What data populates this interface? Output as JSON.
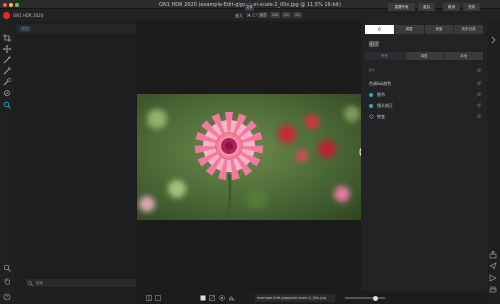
{
  "window": {
    "title": "ON1 HDR 2020 (example-Edit-gigapixel-scale-2_00x.jpg @ 11.5% 16-bit)"
  },
  "app": {
    "name": "ON1 HDR 2020"
  },
  "zoom": {
    "label": "放大",
    "value": "11.67",
    "buttons": [
      "适合",
      "100",
      "50",
      "25"
    ]
  },
  "left_panel": {
    "tab_label": "浏览",
    "search_placeholder": "搜索"
  },
  "right_panel": {
    "tabs": [
      "合",
      "调整",
      "遮盖",
      "历史记录"
    ],
    "section_title": "图层",
    "subtabs": [
      "所有",
      "调整",
      "本地"
    ],
    "layer_badge": "(0)",
    "group_label": "色调&&颜色",
    "rows": [
      "细节",
      "镜头校正",
      "转变"
    ]
  },
  "bottom": {
    "filename_label": "文件 ▸",
    "filename": "example-Edit-gigapixel-scale-2_00x.jpg",
    "buttons": [
      "重置所有",
      "重启",
      "取消",
      "完成"
    ]
  },
  "colors": {
    "accent": "#2fa7c9",
    "logo": "#e02b2b"
  }
}
